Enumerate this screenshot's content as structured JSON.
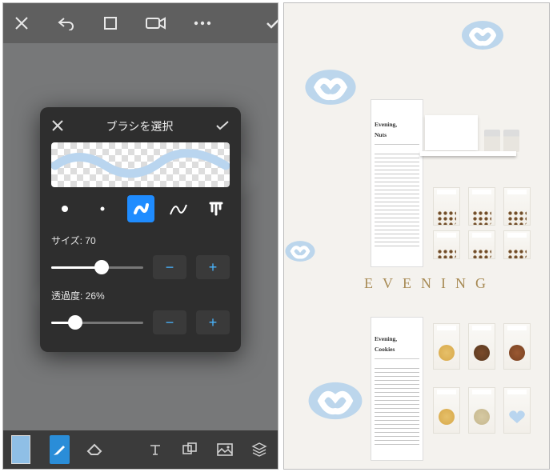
{
  "editor": {
    "modal": {
      "title": "ブラシを選択",
      "close_icon": "close",
      "confirm_icon": "check",
      "brush_options": [
        {
          "name": "solid-small",
          "selected": false
        },
        {
          "name": "solid-large",
          "selected": false
        },
        {
          "name": "swirl",
          "selected": true
        },
        {
          "name": "wave",
          "selected": false
        },
        {
          "name": "drip",
          "selected": false
        }
      ],
      "size": {
        "label": "サイズ: 70",
        "value": 70,
        "min": 1,
        "max": 100,
        "fill_pct": 55
      },
      "opacity": {
        "label": "透過度: 26%",
        "value": 26,
        "min": 0,
        "max": 100,
        "fill_pct": 26
      }
    },
    "topbar": {
      "close": "✕",
      "confirm": "✓"
    },
    "bottombar": {
      "swatch_color": "#8fbfe6",
      "brush_active": true
    }
  },
  "result": {
    "letters": "EVENING",
    "menu1": {
      "title": "Evening,",
      "sub": "Nuts"
    },
    "menu2": {
      "title": "Evening,",
      "sub": "Cookies"
    }
  }
}
